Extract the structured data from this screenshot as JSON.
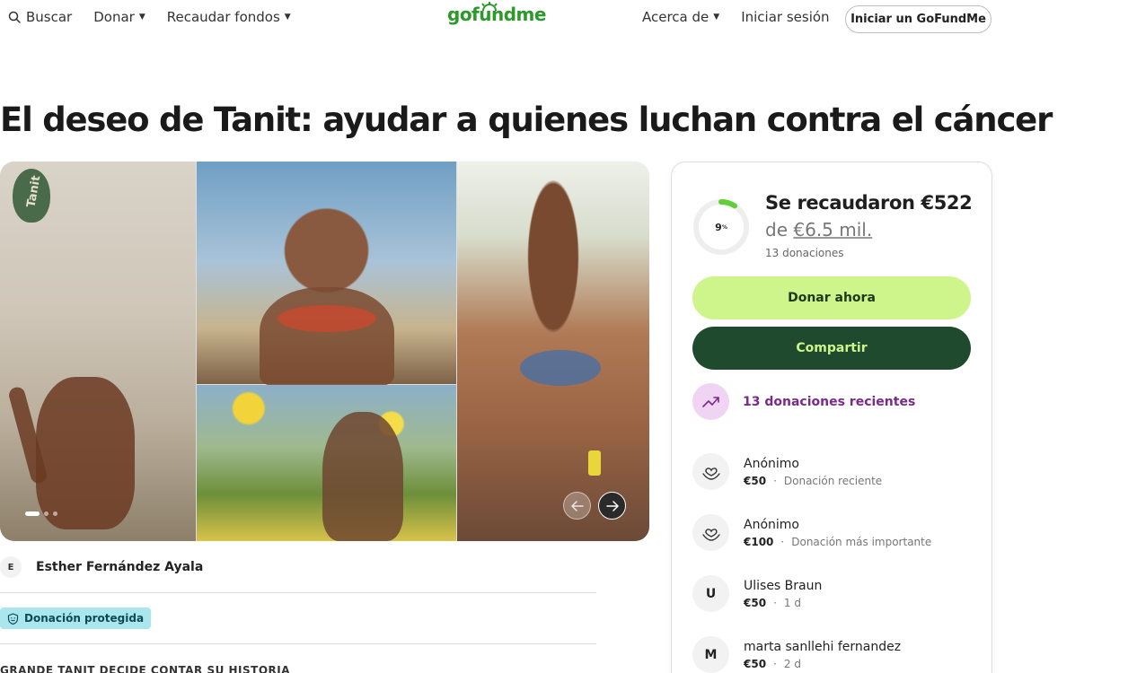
{
  "header": {
    "search_label": "Buscar",
    "donate_label": "Donar",
    "fundraise_label": "Recaudar fondos",
    "logo_text": "gofundme",
    "about_label": "Acerca de",
    "login_label": "Iniciar sesión",
    "start_button_label": "Iniciar un GoFundMe"
  },
  "campaign": {
    "title": "El deseo de Tanit: ayudar a quienes luchan contra el cáncer",
    "racket_text": "Tanit",
    "organizer_initial": "E",
    "organizer_name": "Esther Fernández Ayala",
    "protected_badge": "Donación protegida",
    "truncated_section_text": "GRANDE TANIT DECIDE CONTAR SU HISTORIA"
  },
  "gallery": {
    "slide_count": 3,
    "active_slide": 1,
    "prev_arrow": "←",
    "next_arrow": "→"
  },
  "donation_card": {
    "progress_percent": 9,
    "progress_label": "9",
    "progress_unit": "%",
    "raised_text": "Se recaudaron €522",
    "goal_prefix": "de",
    "goal_amount": "€6.5 mil.",
    "donation_count": "13 donaciones",
    "donate_button": "Donar ahora",
    "share_button": "Compartir",
    "recent_donations_label": "13 donaciones recientes",
    "accent_green": "#cdf58c",
    "dark_green": "#1f4a2e",
    "purple": "#7a2a8a"
  },
  "donors": [
    {
      "initial": "",
      "icon": "heart-hand-icon",
      "name": "Anónimo",
      "amount": "€50",
      "detail": "Donación reciente"
    },
    {
      "initial": "",
      "icon": "heart-hand-icon",
      "name": "Anónimo",
      "amount": "€100",
      "detail": "Donación más importante"
    },
    {
      "initial": "U",
      "icon": "",
      "name": "Ulises Braun",
      "amount": "€50",
      "detail": "1 d"
    },
    {
      "initial": "M",
      "icon": "",
      "name": "marta sanllehi fernandez",
      "amount": "€50",
      "detail": "2 d"
    }
  ]
}
